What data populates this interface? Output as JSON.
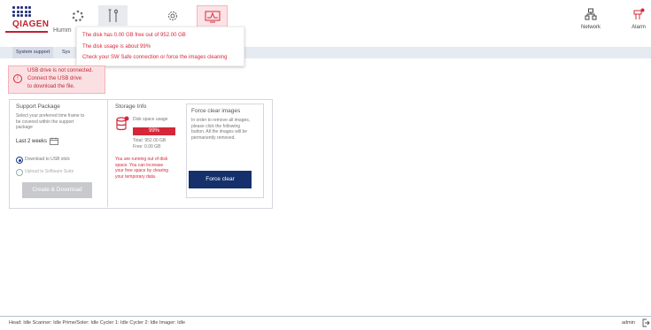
{
  "brand": {
    "logo_text": "QIAGEN",
    "app_name": "Humm",
    "accent": "#c0222f",
    "navy": "#15306b"
  },
  "toolbar": {
    "tools": [
      {
        "icon": "loading-icon",
        "active": false
      },
      {
        "icon": "tools-icon",
        "active": true
      },
      {
        "icon": "gear-icon",
        "active": false
      },
      {
        "icon": "monitor-alert-icon",
        "active": true,
        "alert": true
      }
    ],
    "network_label": "Network",
    "alarm_label": "Alarm"
  },
  "tooltip": {
    "lines": [
      "The disk has 0.00 GB free out of 952.00 GB",
      "The disk usage is about 99%",
      "Check your SW Safe connection or force the images cleaning"
    ]
  },
  "tabs": [
    {
      "label": "System support",
      "active": true
    },
    {
      "label": "Sys",
      "active": false
    }
  ],
  "usb_warning": {
    "lines": [
      "USB drive is not connected.",
      "Connect the USB drive",
      "to download the file."
    ]
  },
  "support": {
    "title": "Support Package",
    "desc": [
      "Select your preferred time frame to",
      "be covered within the support",
      "package"
    ],
    "range_label": "Last 2 weeks",
    "option_usb": "Download to USB stick",
    "option_upload": "Upload to Software Suite",
    "button": "Create & Download"
  },
  "storage": {
    "title": "Storage Info",
    "usage_label": "Disk space usage",
    "usage_pct": "99%",
    "total": "Total: 952.00 GB",
    "free": "Free: 0.00 GB",
    "warning": [
      "You are running out of disk",
      "space. You can increase",
      "your free space by clearing",
      "your temporary data."
    ]
  },
  "force": {
    "title": "Force clear images",
    "desc": [
      "In order to remove all images,",
      "please click the following",
      "button. All the images will be",
      "permanently removed."
    ],
    "button": "Force clear"
  },
  "status": {
    "text": "Head: Idle   Scanner: Idle   Prime/Soler: Idle   Cycler 1: Idle   Cycler 2: Idle   Imager: Idle",
    "user": "admin"
  }
}
